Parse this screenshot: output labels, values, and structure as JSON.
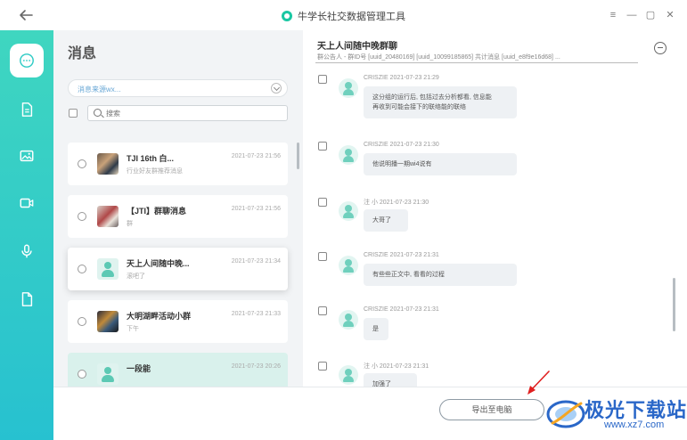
{
  "app": {
    "title": "牛学长社交数据管理工具"
  },
  "window_controls": {
    "menu": "≡",
    "minimize": "—",
    "maximize": "▢",
    "close": "✕"
  },
  "sidebar": {
    "items": [
      {
        "name": "messages",
        "icon": "chat-bubble-icon",
        "active": true
      },
      {
        "name": "files",
        "icon": "document-icon",
        "active": false
      },
      {
        "name": "photos",
        "icon": "image-icon",
        "active": false
      },
      {
        "name": "videos",
        "icon": "video-icon",
        "active": false
      },
      {
        "name": "voice",
        "icon": "microphone-icon",
        "active": false
      },
      {
        "name": "attachments",
        "icon": "file-icon",
        "active": false
      }
    ],
    "accent": "#2fcbc5"
  },
  "messages_panel": {
    "title": "消息",
    "account_select": "消息来源wx...",
    "search_placeholder": "搜索",
    "conversations": [
      {
        "name": "TJI 16th 白...",
        "subtitle": "行业好友群推荐消息",
        "time": "2021-07-23 21:56"
      },
      {
        "name": "【JTI】群聊消息",
        "subtitle": "群",
        "time": "2021-07-23 21:56"
      },
      {
        "name": "天上人间随中晚...",
        "subtitle": "滚吧了",
        "time": "2021-07-23 21:34"
      },
      {
        "name": "大明湖畔活动小群",
        "subtitle": "下午",
        "time": "2021-07-23 21:33"
      },
      {
        "name": "一段能",
        "subtitle": "",
        "time": "2021-07-23 20:26"
      }
    ]
  },
  "chat": {
    "title": "天上人间随中晚群聊",
    "subtitle": "群公告人 - 群ID号 [uuid_20480169] [uuid_10099185865] 共计消息 [uuid_e8f9e16d68] ...",
    "messages": [
      {
        "meta": "CRISZIE 2021-07-23 21:29",
        "text": "这分组的运行后, 包括过去分析都看, 信息能\n再收到可能会接下的联络能的联络"
      },
      {
        "meta": "CRISZIE 2021-07-23 21:30",
        "text": "他说明播一期wi4说有"
      },
      {
        "meta": "注 小 2021-07-23 21:30",
        "text": "大哥了"
      },
      {
        "meta": "CRISZIE 2021-07-23 21:31",
        "text": "有些些正文中, 看看的过程"
      },
      {
        "meta": "CRISZIE 2021-07-23 21:31",
        "text": "是"
      },
      {
        "meta": "注 小 2021-07-23 21:31",
        "text": "加强了"
      }
    ]
  },
  "bottom": {
    "export_label": "导出至电脑"
  },
  "watermark": {
    "text": "极光下载站",
    "url": "www.xz7.com"
  }
}
